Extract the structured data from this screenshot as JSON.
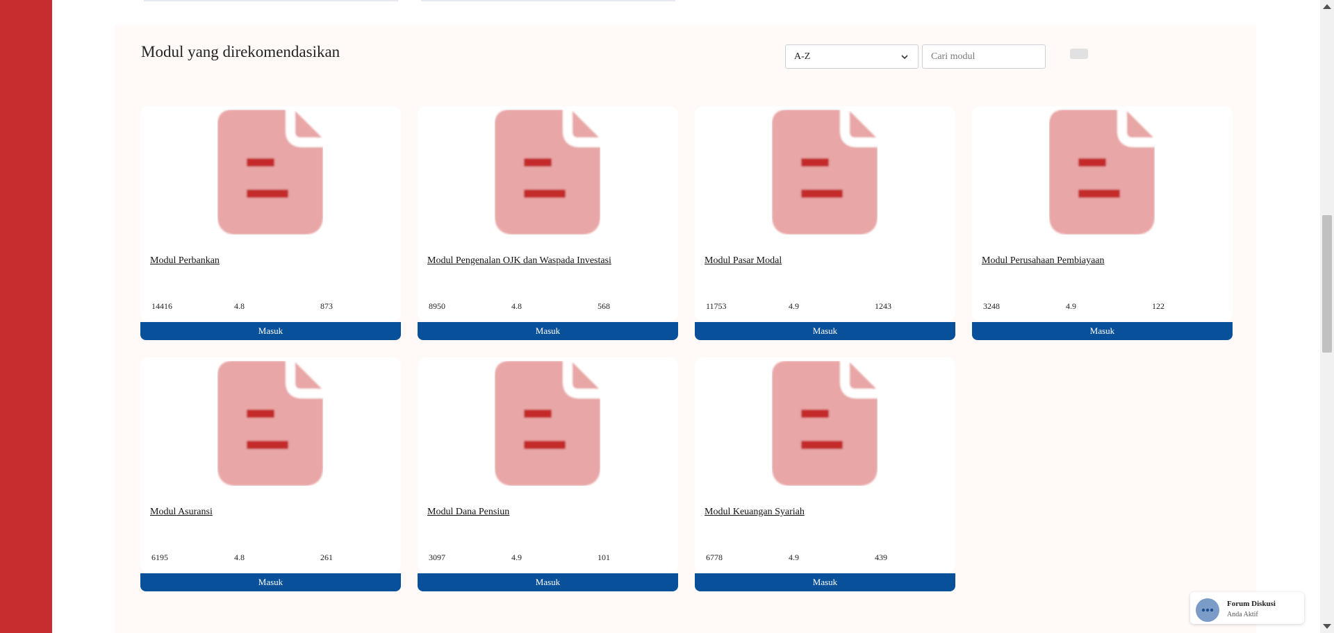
{
  "section": {
    "title": "Modul yang direkomendasikan"
  },
  "controls": {
    "sort_value": "A-Z",
    "search_placeholder": "Cari modul"
  },
  "modules": [
    {
      "title": "Modul Perbankan",
      "stats": [
        "14416",
        "4.8",
        "873"
      ],
      "button_label": "Masuk"
    },
    {
      "title": "Modul Pengenalan OJK dan Waspada Investasi",
      "stats": [
        "8950",
        "4.8",
        "568"
      ],
      "button_label": "Masuk"
    },
    {
      "title": "Modul Pasar Modal",
      "stats": [
        "11753",
        "4.9",
        "1243"
      ],
      "button_label": "Masuk"
    },
    {
      "title": "Modul Perusahaan Pembiayaan",
      "stats": [
        "3248",
        "4.9",
        "122"
      ],
      "button_label": "Masuk"
    },
    {
      "title": "Modul Asuransi",
      "stats": [
        "6195",
        "4.8",
        "261"
      ],
      "button_label": "Masuk"
    },
    {
      "title": "Modul Dana Pensiun",
      "stats": [
        "3097",
        "4.9",
        "101"
      ],
      "button_label": "Masuk"
    },
    {
      "title": "Modul Keuangan Syariah",
      "stats": [
        "6778",
        "4.9",
        "439"
      ],
      "button_label": "Masuk"
    }
  ],
  "forum": {
    "title": "Forum Diskusi",
    "status": "Anda Aktif"
  },
  "icons": {
    "module_thumbnail": "document-icon",
    "chat": "chat-bubble-icon",
    "sort_chevron": "chevron-down-icon"
  },
  "colors": {
    "sidebar": "#c62d2e",
    "button": "#08509a",
    "doc_icon": "#e8a6a6",
    "doc_icon_lines": "#c42a2a"
  }
}
